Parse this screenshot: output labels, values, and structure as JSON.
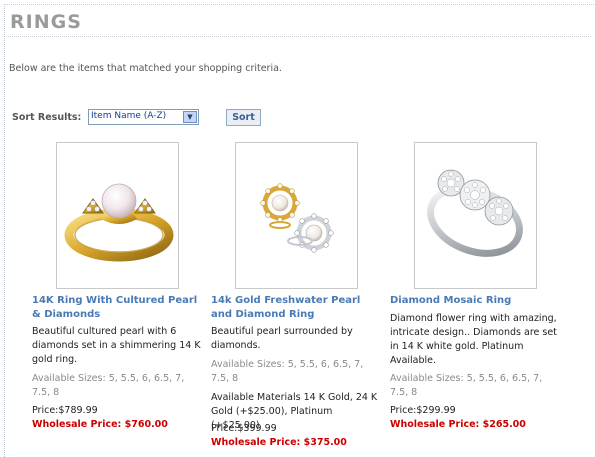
{
  "page": {
    "title": "RINGS",
    "intro": "Below are the items that matched your shopping criteria."
  },
  "sort": {
    "label": "Sort Results:",
    "selected": "Item Name (A-Z)",
    "button": "Sort"
  },
  "products": [
    {
      "name": "14K Ring With Cultured Pearl & Diamonds",
      "description": "Beautiful cultured pearl with 6 diamonds set in a shimmering 14 K gold ring.",
      "sizes": "Available Sizes: 5, 5.5, 6, 6.5, 7, 7.5, 8",
      "materials": "",
      "price": "Price:$789.99",
      "wholesale": "Wholesale Price: $760.00",
      "image_icon": "gold-pearl-ring-image"
    },
    {
      "name": "14k Gold Freshwater Pearl and Diamond Ring",
      "description": "Beautiful pearl surrounded by diamonds.",
      "sizes": "Available Sizes: 5, 5.5, 6, 6.5, 7, 7.5, 8",
      "materials": "Available Materials 14 K Gold, 24 K Gold (+$25.00), Platinum (+$25.00)",
      "price": "Price:$399.99",
      "wholesale": "Wholesale Price: $375.00",
      "image_icon": "freshwater-pearl-rings-image"
    },
    {
      "name": "Diamond Mosaic Ring",
      "description": "Diamond flower ring with amazing, intricate design.. Diamonds are set in 14 K white gold. Platinum Available.",
      "sizes": "Available Sizes: 5, 5.5, 6, 6.5, 7, 7.5, 8",
      "materials": "",
      "price": "Price:$299.99",
      "wholesale": "Wholesale Price: $265.00",
      "image_icon": "diamond-mosaic-ring-image"
    }
  ],
  "colors": {
    "link": "#4a7ab5",
    "wholesale": "#cc0000",
    "title": "#9a9a9a"
  }
}
